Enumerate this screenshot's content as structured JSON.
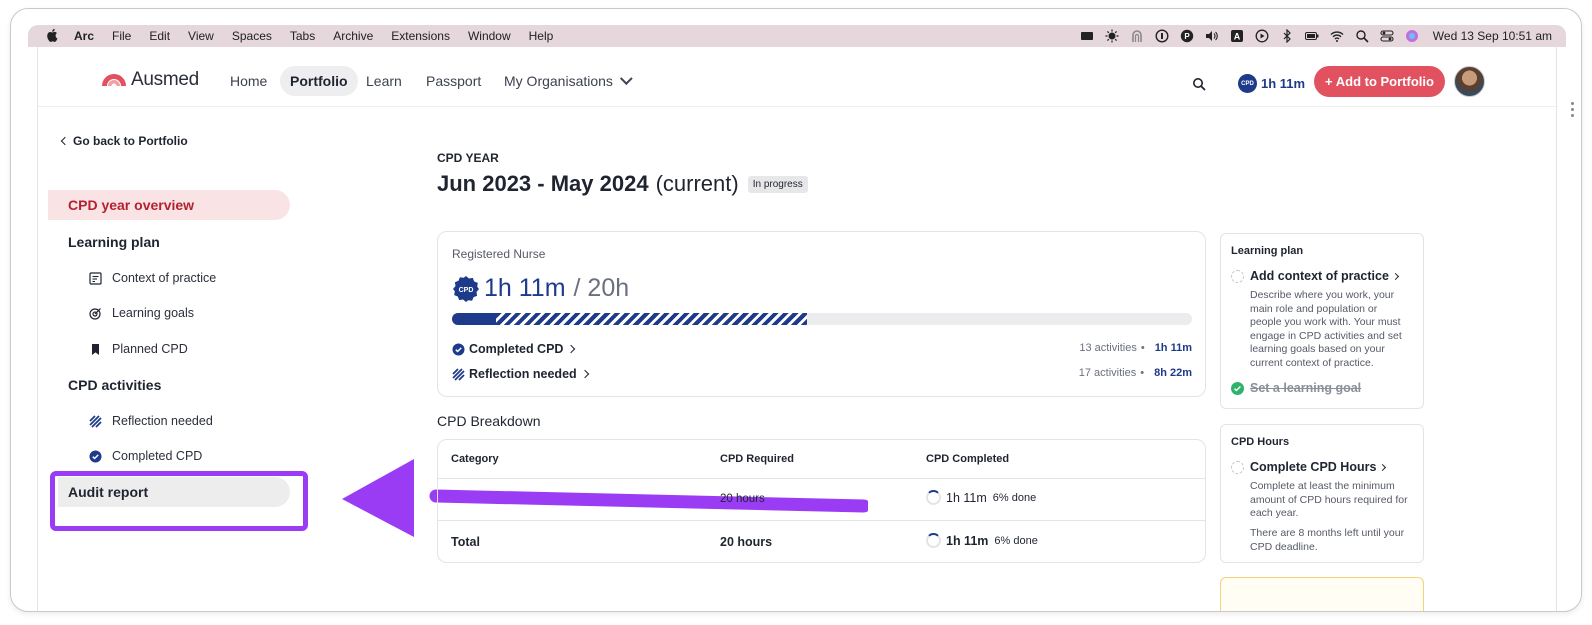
{
  "macbar": {
    "app_name": "Arc",
    "menus": [
      "File",
      "Edit",
      "View",
      "Spaces",
      "Tabs",
      "Archive",
      "Extensions",
      "Window",
      "Help"
    ],
    "clock": "Wed 13 Sep  10:51 am"
  },
  "nav": {
    "brand": "Ausmed",
    "links": [
      "Home",
      "Portfolio",
      "Learn",
      "Passport",
      "My Organisations"
    ],
    "active": "Portfolio",
    "cpd_badge_text": "CPD",
    "cpd_time": "1h 11m",
    "add_button": "+ Add to Portfolio"
  },
  "sidebar": {
    "back_link": "Go back to Portfolio",
    "overview": "CPD year overview",
    "learning_plan": {
      "heading": "Learning plan",
      "items": [
        {
          "label": "Context of practice",
          "icon": "clipboard-icon"
        },
        {
          "label": "Learning goals",
          "icon": "target-icon"
        },
        {
          "label": "Planned CPD",
          "icon": "bookmark-icon"
        }
      ]
    },
    "cpd_activities": {
      "heading": "CPD activities",
      "items": [
        {
          "label": "Reflection needed",
          "icon": "striped-icon"
        },
        {
          "label": "Completed CPD",
          "icon": "check-circle-icon"
        }
      ]
    },
    "audit_report": "Audit report"
  },
  "main": {
    "year_label": "CPD YEAR",
    "year_title": "Jun 2023 - May 2024",
    "year_current": "(current)",
    "status": "In progress",
    "progress": {
      "role": "Registered Nurse",
      "badge_text": "CPD",
      "completed": "1h 11m",
      "separator_total": "/ 20h",
      "completed_fraction": 0.06,
      "pending_fraction": 0.42,
      "rows": [
        {
          "label": "Completed CPD",
          "activities": "13 activities",
          "time": "1h 11m"
        },
        {
          "label": "Reflection needed",
          "activities": "17 activities",
          "time": "8h 22m"
        }
      ]
    },
    "breakdown": {
      "title": "CPD Breakdown",
      "headers": [
        "Category",
        "CPD Required",
        "CPD Completed"
      ],
      "rows": [
        {
          "category": "",
          "required": "20 hours",
          "completed": "1h 11m",
          "pct": "6% done"
        }
      ],
      "total": {
        "label": "Total",
        "required": "20 hours",
        "completed": "1h 11m",
        "pct": "6% done"
      }
    }
  },
  "right": {
    "learning_plan_card": {
      "title": "Learning plan",
      "task": "Add context of practice",
      "desc": "Describe where you work, your main role and population or people you work with. Your must engage in CPD activities and set learning goals based on your current context of practice.",
      "done_task": "Set a learning goal"
    },
    "cpd_hours_card": {
      "title": "CPD Hours",
      "task": "Complete CPD Hours",
      "desc": "Complete at least the minimum amount of CPD hours required for each year.",
      "note": "There are 8 months left until your CPD deadline."
    }
  },
  "colors": {
    "brand_red": "#e2515f",
    "navy": "#1e3a8a",
    "highlight_purple": "#9b3cf5",
    "active_pink": "#f9e3e5"
  }
}
